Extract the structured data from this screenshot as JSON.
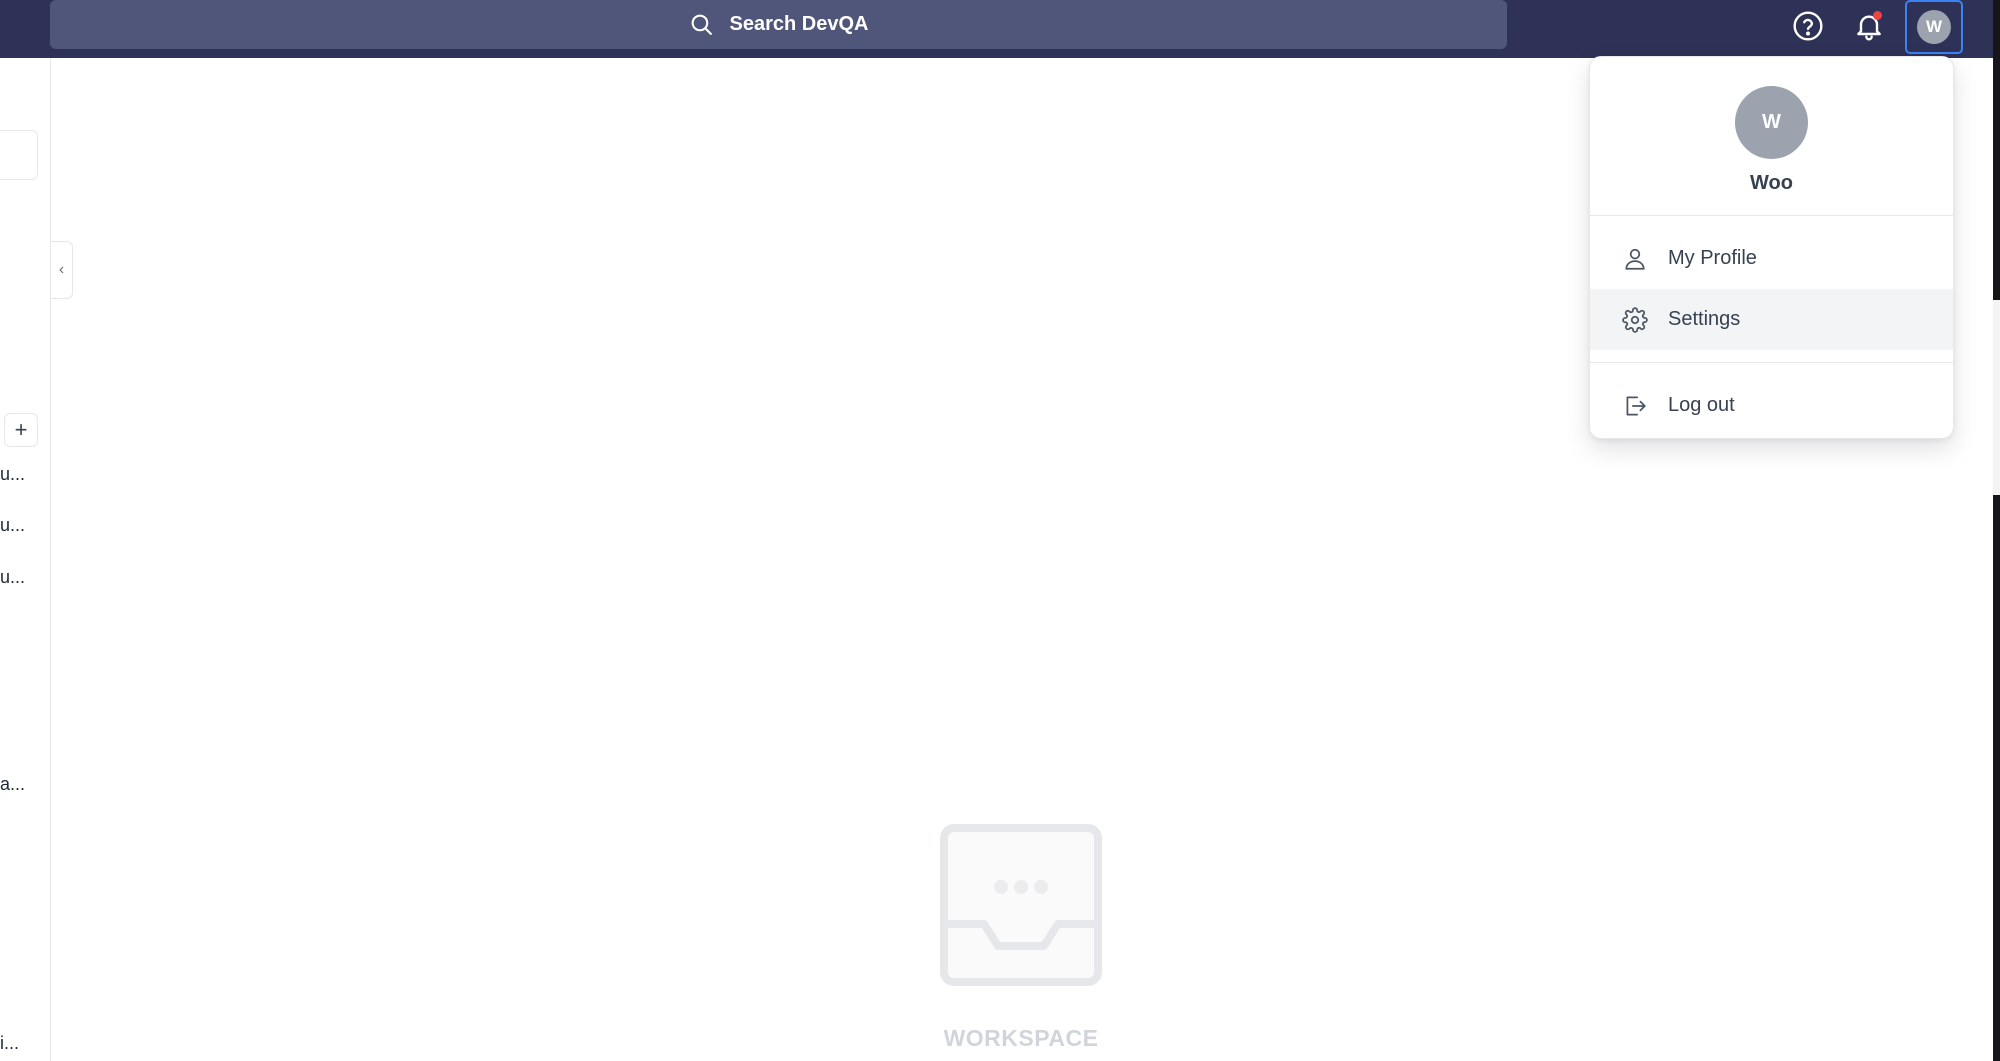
{
  "search": {
    "placeholder": "Search DevQA"
  },
  "header": {
    "avatar_initial": "W",
    "notification_unread": true
  },
  "sidebar": {
    "add_label": "+",
    "collapse_label": "‹",
    "items": [
      {
        "text": "u..."
      },
      {
        "text": "u..."
      },
      {
        "text": "u..."
      },
      {
        "text": "a..."
      },
      {
        "text": "i..."
      }
    ]
  },
  "user_menu": {
    "avatar_initial": "W",
    "name": "Woo",
    "items": [
      {
        "label": "My Profile",
        "icon": "user-icon",
        "active": false
      },
      {
        "label": "Settings",
        "icon": "gear-icon",
        "active": true
      },
      {
        "label": "Log out",
        "icon": "logout-icon",
        "active": false
      }
    ]
  },
  "workspace": {
    "empty_label": "WORKSPACE"
  },
  "colors": {
    "topbar": "#2e3256",
    "search_bg": "#50557a",
    "focus_ring": "#3b82f6",
    "avatar_bg": "#9ca3af",
    "notification_dot": "#ef4444"
  }
}
